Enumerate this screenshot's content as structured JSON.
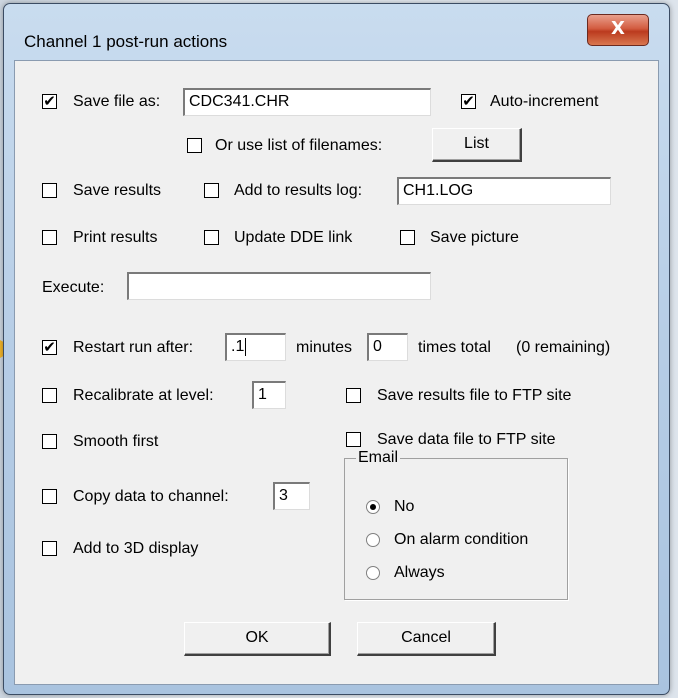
{
  "window": {
    "title": "Channel 1 post-run actions",
    "close_label": "X"
  },
  "save_file": {
    "checked": true,
    "label": "Save file as:",
    "value": "CDC341.CHR"
  },
  "auto_increment": {
    "checked": true,
    "label": "Auto-increment"
  },
  "use_list": {
    "checked": false,
    "label": "Or use list of filenames:",
    "button": "List"
  },
  "save_results": {
    "checked": false,
    "label": "Save results"
  },
  "add_to_log": {
    "checked": false,
    "label": "Add to results log:",
    "value": "CH1.LOG"
  },
  "print_results": {
    "checked": false,
    "label": "Print results"
  },
  "update_dde": {
    "checked": false,
    "label": "Update DDE link"
  },
  "save_picture": {
    "checked": false,
    "label": "Save picture"
  },
  "execute": {
    "label": "Execute:",
    "value": ""
  },
  "restart": {
    "checked": true,
    "label": "Restart run after:",
    "minutes_value": ".1",
    "minutes_label": "minutes",
    "times_value": "0",
    "times_label": "times total",
    "remaining": "(0 remaining)"
  },
  "recalibrate": {
    "checked": false,
    "label": "Recalibrate at level:",
    "value": "1"
  },
  "ftp_results": {
    "checked": false,
    "label": "Save results file to FTP site"
  },
  "smooth_first": {
    "checked": false,
    "label": "Smooth first"
  },
  "ftp_data": {
    "checked": false,
    "label": "Save data file to FTP site"
  },
  "copy_data": {
    "checked": false,
    "label": "Copy data to channel:",
    "value": "3"
  },
  "add_3d": {
    "checked": false,
    "label": "Add to 3D display"
  },
  "email": {
    "legend": "Email",
    "options": [
      "No",
      "On alarm condition",
      "Always"
    ],
    "selected": "No"
  },
  "buttons": {
    "ok": "OK",
    "cancel": "Cancel"
  },
  "colors": {
    "accent_arrow": "#f2b52a",
    "close_button": "#c8452b"
  }
}
